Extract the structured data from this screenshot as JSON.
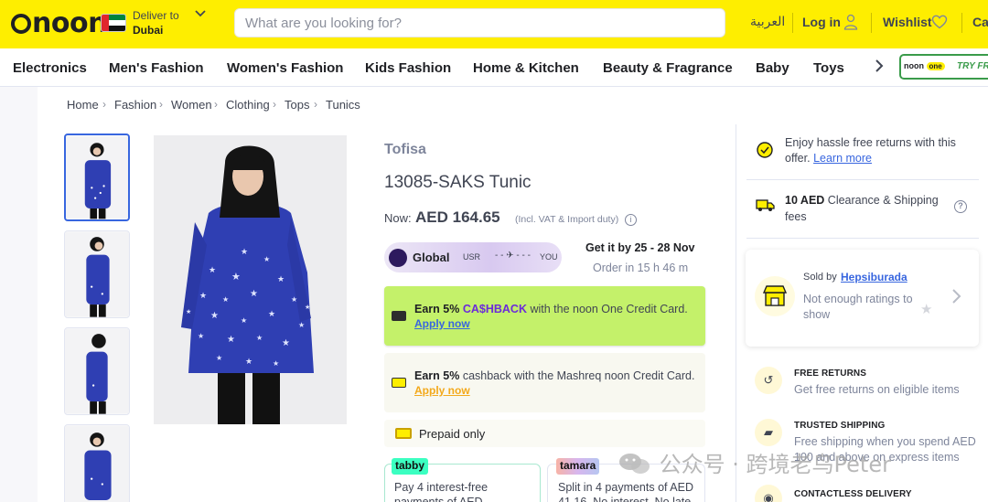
{
  "header": {
    "logo": "noon",
    "deliver_label": "Deliver to",
    "deliver_city": "Dubai",
    "search_placeholder": "What are you looking for?",
    "language": "العربية",
    "login": "Log in",
    "wishlist": "Wishlist",
    "cart": "Ca",
    "accent": "#feee00"
  },
  "nav": {
    "items": [
      "Electronics",
      "Men's Fashion",
      "Women's Fashion",
      "Kids Fashion",
      "Home & Kitchen",
      "Beauty & Fragrance",
      "Baby",
      "Toys"
    ],
    "promo_brand": "noon",
    "promo_one": "one",
    "promo_try": "TRY FR"
  },
  "breadcrumb": [
    "Home",
    "Fashion",
    "Women",
    "Clothing",
    "Tops",
    "Tunics"
  ],
  "product": {
    "brand": "Tofisa",
    "title": "13085-SAKS Tunic",
    "now_label": "Now:",
    "price": "AED 164.65",
    "vat_note": "(Incl. VAT & Import duty)",
    "global_label": "Global",
    "from_label": "USR",
    "to_label": "YOU",
    "delivery_date": "Get it by 25 - 28 Nov",
    "order_within": "Order in 15 h 46 m"
  },
  "promos": [
    {
      "prefix": "Earn 5%",
      "highlight": "CA$HBACK",
      "rest": " with the noon One Credit Card.",
      "link": "Apply now",
      "link_color": "#3866df",
      "bg": "#c4f16a"
    },
    {
      "prefix": "Earn 5%",
      "highlight": "",
      "rest": " cashback with the Mashreq noon Credit Card.",
      "link": "Apply now",
      "link_color": "#f3a91b",
      "bg": "#f8f8f0"
    }
  ],
  "payment": {
    "prepaid": "Prepaid only",
    "tabby_logo": "tabby",
    "tabby_text": "Pay 4 interest-free payments of AED",
    "tamara_logo": "tamara",
    "tamara_text": "Split in 4 payments of AED 41.16. No interest. No late"
  },
  "sidebar": {
    "returns_text": "Enjoy hassle free returns with this offer.",
    "returns_link": "Learn more",
    "shipping_amount": "10 AED",
    "shipping_text": " Clearance & Shipping fees",
    "sold_by": "Sold by",
    "seller": "Hepsiburada",
    "rating_text": "Not enough ratings to show",
    "features": [
      {
        "title": "FREE RETURNS",
        "desc": "Get free returns on eligible items",
        "icon": "return-icon"
      },
      {
        "title": "TRUSTED SHIPPING",
        "desc": "Free shipping when you spend AED 100 and above on express items",
        "icon": "truck-icon"
      },
      {
        "title": "CONTACTLESS DELIVERY",
        "desc": "",
        "icon": "contactless-icon"
      }
    ]
  },
  "watermark": "公众号 · 跨境老鸟Peter"
}
